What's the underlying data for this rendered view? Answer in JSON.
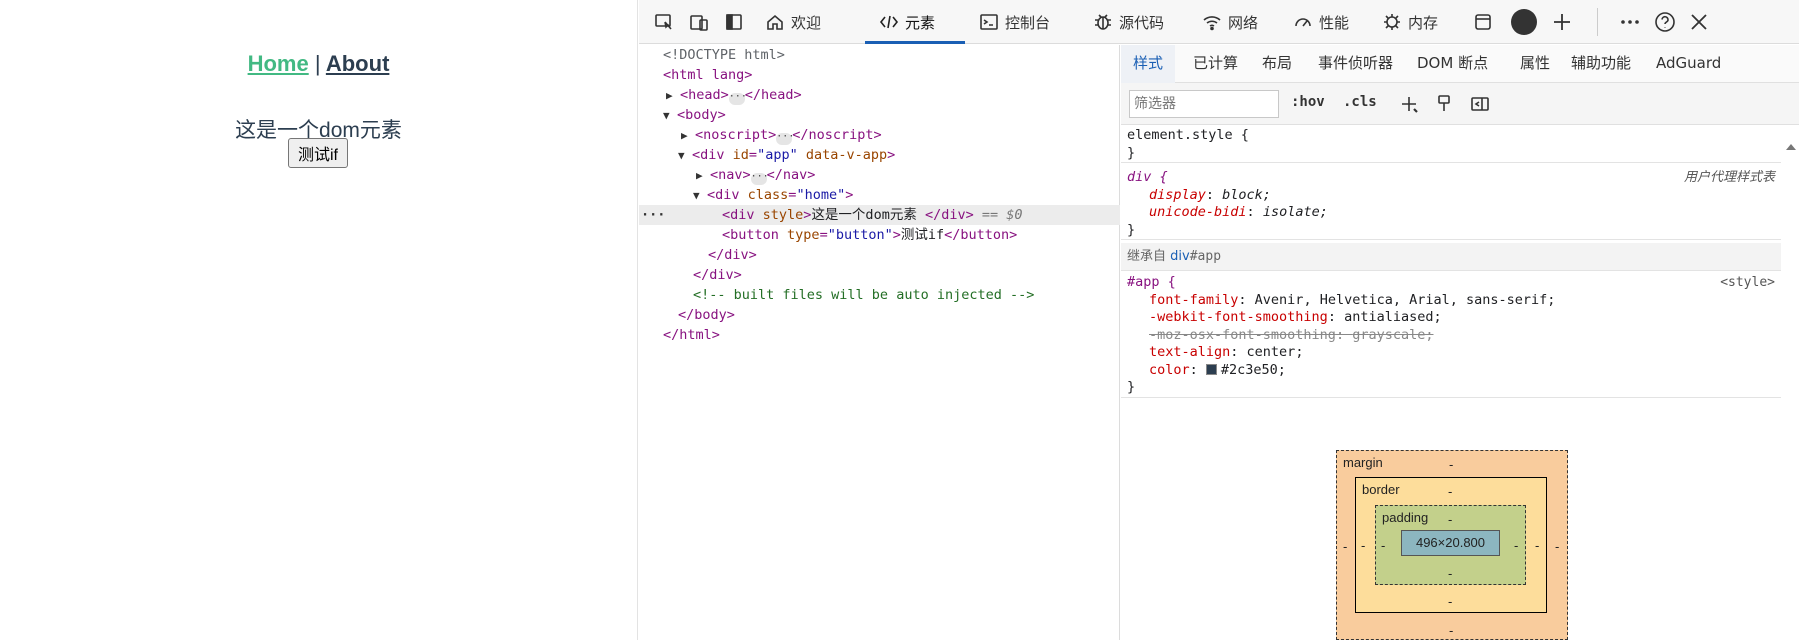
{
  "page": {
    "nav": {
      "home": "Home",
      "sep": "|",
      "about": "About"
    },
    "dom_text": "这是一个dom元素",
    "test_button": "测试if"
  },
  "devtools": {
    "tabs": [
      {
        "label": "欢迎",
        "icon": "home-icon"
      },
      {
        "label": "元素",
        "icon": "code-icon"
      },
      {
        "label": "控制台",
        "icon": "console-icon"
      },
      {
        "label": "源代码",
        "icon": "bug-icon"
      },
      {
        "label": "网络",
        "icon": "wifi-icon"
      },
      {
        "label": "性能",
        "icon": "gauge-icon"
      },
      {
        "label": "内存",
        "icon": "chip-icon"
      }
    ],
    "active_tab": "元素",
    "dom": {
      "doctype": "<!DOCTYPE html>",
      "html_open": "<html lang>",
      "head": "<head>",
      "head_close": "</head>",
      "body": "<body>",
      "noscript": "<noscript>",
      "noscript_close": "</noscript>",
      "div_app_tag": "<div",
      "div_app_attr1": "id",
      "div_app_val1": "\"app\"",
      "div_app_attr2": "data-v-app",
      "nav": "<nav>",
      "nav_close": "</nav>",
      "div_home_tag": "<div",
      "div_home_attr": "class",
      "div_home_val": "\"home\"",
      "div_style_tag": "<div",
      "div_style_attr": "style",
      "div_style_text": "这是一个dom元素 ",
      "div_close": "</div>",
      "eq0": "== $0",
      "button_tag": "<button",
      "button_attr": "type",
      "button_val": "\"button\"",
      "button_text": "测试if",
      "button_close": "</button>",
      "comment": "<!-- built files will be auto injected -->",
      "body_close": "</body>",
      "html_close": "</html>"
    },
    "styles": {
      "sub_tabs": [
        "样式",
        "已计算",
        "布局",
        "事件侦听器",
        "DOM 断点",
        "属性",
        "辅助功能",
        "AdGuard"
      ],
      "filter_placeholder": "筛选器",
      "hov": ":hov",
      "cls": ".cls",
      "element_style": "element.style {",
      "close_brace": "}",
      "ua_selector": "div {",
      "ua_source": "用户代理样式表",
      "ua_props": [
        {
          "name": "display",
          "value": "block;"
        },
        {
          "name": "unicode-bidi",
          "value": "isolate;"
        }
      ],
      "inherited_label": "继承自",
      "inherited_el": "div",
      "inherited_id": "#app",
      "app_selector": "#app {",
      "app_source": "<style>",
      "app_props": [
        {
          "name": "font-family",
          "value": "Avenir, Helvetica, Arial, sans-serif;"
        },
        {
          "name": "-webkit-font-smoothing",
          "value": "antialiased;"
        },
        {
          "name": "-moz-osx-font-smoothing",
          "value": "grayscale;"
        },
        {
          "name": "text-align",
          "value": "center;"
        },
        {
          "name": "color",
          "value": "#2c3e50;"
        }
      ],
      "color_swatch": "#2c3e50"
    },
    "box_model": {
      "margin": "margin",
      "border": "border",
      "padding": "padding",
      "content": "496×20.800",
      "dash": "-"
    }
  },
  "colors": {
    "link_active": "#42b983",
    "text": "#2c3e50",
    "accent": "#1a5fb4",
    "bm_margin": "#f9cc9d",
    "bm_border": "#fddd9b",
    "bm_padding": "#c3d08b",
    "bm_content": "#8cb6c0"
  }
}
